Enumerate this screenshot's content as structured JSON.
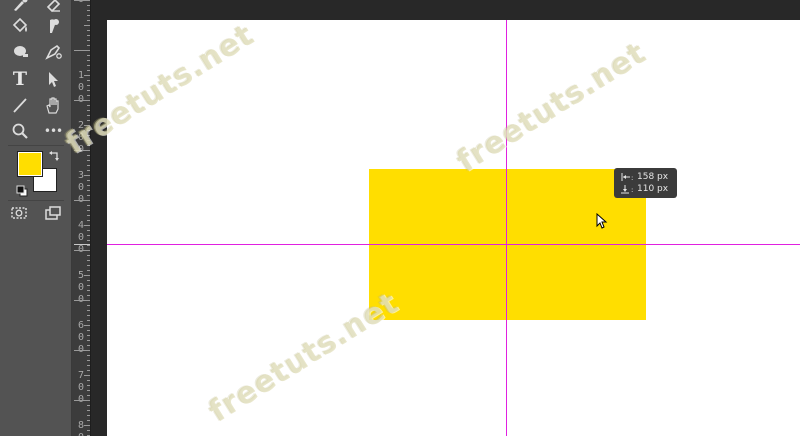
{
  "toolbar": {
    "tools": [
      {
        "id": "brush",
        "icon": "brush-icon"
      },
      {
        "id": "eraser",
        "icon": "eraser-icon"
      },
      {
        "id": "paint-bucket",
        "icon": "paint-bucket-icon"
      },
      {
        "id": "smudge",
        "icon": "smudge-icon"
      },
      {
        "id": "dodge",
        "icon": "dodge-icon"
      },
      {
        "id": "pen",
        "icon": "pen-icon"
      },
      {
        "id": "type",
        "icon": "type-icon",
        "label": "T"
      },
      {
        "id": "path-selection",
        "icon": "path-selection-icon"
      },
      {
        "id": "line",
        "icon": "line-icon"
      },
      {
        "id": "hand",
        "icon": "hand-icon"
      },
      {
        "id": "zoom",
        "icon": "zoom-icon"
      },
      {
        "id": "more-tools",
        "icon": "more-icon",
        "label": "•••"
      },
      {
        "id": "quick-mask",
        "icon": "quick-mask-icon"
      },
      {
        "id": "screen-mode",
        "icon": "screen-mode-icon"
      }
    ],
    "foreground_color": "#ffde00",
    "background_color": "#ffffff"
  },
  "ruler": {
    "labels": [
      {
        "text": "0"
      },
      {
        "text": "1\n0\n0"
      },
      {
        "text": "2\n0\n0"
      },
      {
        "text": "3\n0\n0"
      },
      {
        "text": "4\n0\n0"
      },
      {
        "text": "5\n0\n0"
      },
      {
        "text": "6\n0\n0"
      },
      {
        "text": "7\n0\n0"
      },
      {
        "text": "8\n0"
      }
    ]
  },
  "canvas": {
    "background": "#ffffff",
    "shape_fill": "#ffde00",
    "guide_color": "#e020e0"
  },
  "hud": {
    "width_value": "158 px",
    "height_value": "110 px"
  },
  "watermark": {
    "text": "freetuts.net"
  }
}
